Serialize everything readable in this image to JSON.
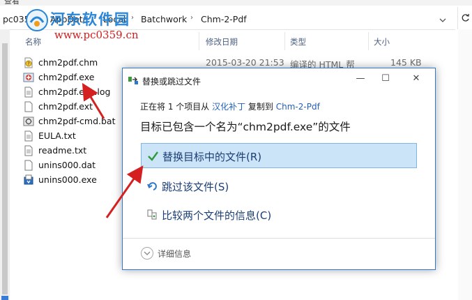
{
  "explorer": {
    "menu_label": "查看",
    "breadcrumbs": [
      "pc0359",
      "AppData",
      "Local",
      "Batchwork",
      "Chm-2-Pdf"
    ],
    "columns": {
      "name": "名称",
      "date": "修改日期",
      "type": "类型",
      "size": "大小"
    },
    "files": [
      {
        "name": "chm2pdf.chm",
        "date": "2015-03-20 21:53",
        "type": "编译的 HTML 帮",
        "size": "145 KB",
        "icon": "chm-help-icon"
      },
      {
        "name": "chm2pdf.exe",
        "icon": "exe-app-icon"
      },
      {
        "name": "chm2pdf.exe.log",
        "icon": "text-file-icon"
      },
      {
        "name": "chm2pdf.ext",
        "icon": "blank-file-icon"
      },
      {
        "name": "chm2pdf-cmd.bat",
        "icon": "batch-file-icon"
      },
      {
        "name": "EULA.txt",
        "icon": "text-file-icon"
      },
      {
        "name": "readme.txt",
        "icon": "text-file-icon"
      },
      {
        "name": "unins000.dat",
        "icon": "blank-file-icon"
      },
      {
        "name": "unins000.exe",
        "icon": "installer-exe-icon"
      }
    ]
  },
  "watermark": {
    "site": "河东软件园",
    "url": "www.pc0359.cn"
  },
  "dialog": {
    "title": "替换或跳过文件",
    "copy_prefix": "正在将 1 个项目从 ",
    "copy_source": "汉化补丁",
    "copy_middle": " 复制到 ",
    "copy_dest": "Chm-2-Pdf",
    "heading": "目标已包含一个名为“chm2pdf.exe”的文件",
    "options": {
      "replace": "替换目标中的文件(R)",
      "skip": "跳过该文件(S)",
      "compare": "比较两个文件的信息(C)"
    },
    "details": "详细信息",
    "buttons": {
      "minimize": "—",
      "maximize": "☐",
      "close": "✕"
    }
  },
  "colors": {
    "accent": "#2f78c8",
    "link": "#2260b8",
    "option_text": "#1b3e76",
    "arrow": "#d42020"
  }
}
